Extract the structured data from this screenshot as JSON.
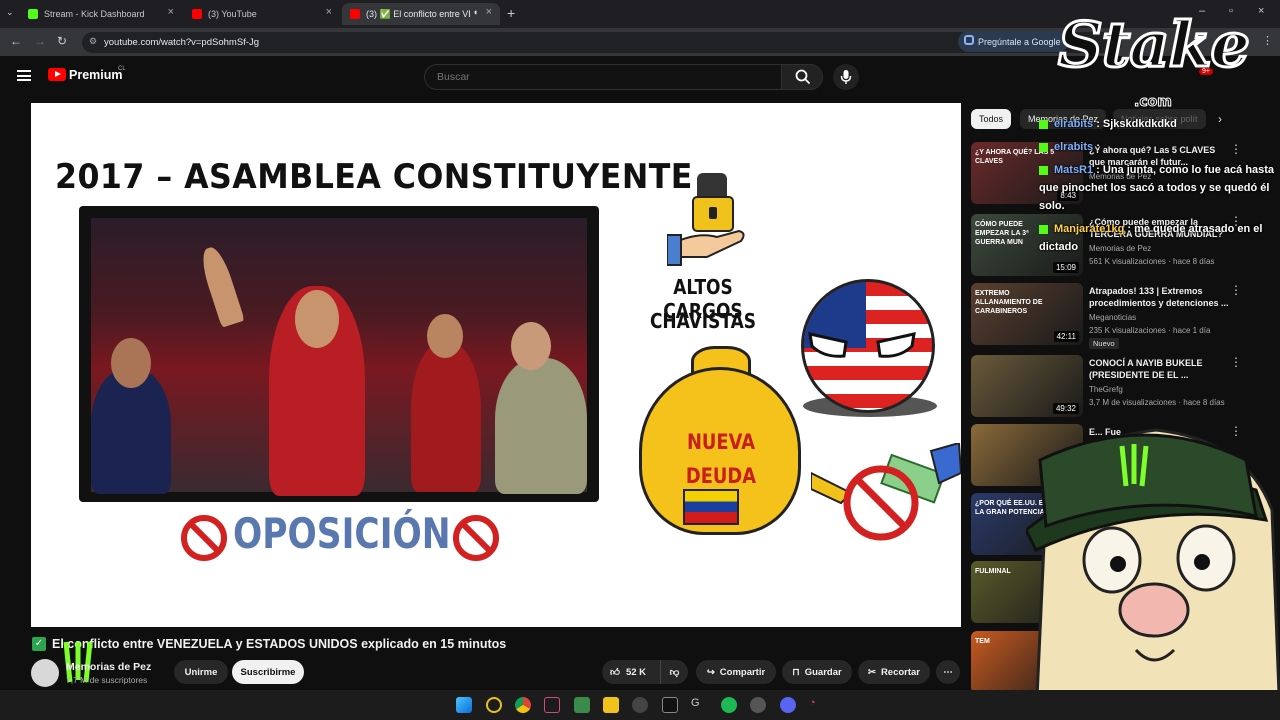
{
  "browser": {
    "tabs": [
      {
        "title": "Stream - Kick Dashboard",
        "fav_color": "#53fc18"
      },
      {
        "title": "(3) YouTube",
        "fav_color": "#ff0000"
      },
      {
        "title": "(3) ✅ El conflicto entre VE…",
        "fav_color": "#ff0000"
      }
    ],
    "new_tab": "+",
    "url": "youtube.com/watch?v=pdSohmSf-Jg",
    "ask_google": "Pregúntale a Google"
  },
  "youtube": {
    "brand": "Premium",
    "country": "CL",
    "search_placeholder": "Buscar",
    "notif_count": "9+"
  },
  "video": {
    "heading": "2017 –  ASAMBLEA CONSTITUYENTE",
    "label_cargos_1": "ALTOS CARGOS",
    "label_cargos_2": "CHAVISTAS",
    "label_deuda_1": "NUEVA",
    "label_deuda_2": "DEUDA",
    "label_oposicion": "OPOSICIÓN"
  },
  "meta": {
    "title": "El conflicto entre VENEZUELA y ESTADOS UNIDOS explicado en 15 minutos",
    "channel": "Memorias de Pez",
    "subs": "7,7 M de suscriptores",
    "join": "Unirme",
    "subscribe": "Suscribirme",
    "likes": "52 K",
    "share": "Compartir",
    "save": "Guardar",
    "clip": "Recortar"
  },
  "sidebar": {
    "chips": [
      "Todos",
      "Memorias de Pez",
      "Noticias sobre polít"
    ],
    "items": [
      {
        "thumb_text": "¿Y AHORA QUÉ? LAS 5 CLAVES",
        "title": "¿Y ahora qué? Las 5 CLAVES que marcarán el futur...",
        "channel": "Memorias de Pez",
        "meta": "",
        "duration": "8:43",
        "color": "#6b2a2a"
      },
      {
        "thumb_text": "CÓMO PUEDE EMPEZAR LA 3ª GUERRA MUN",
        "title": "¿Cómo puede empezar la TERCERA GUERRA MUNDIAL?",
        "channel": "Memorias de Pez",
        "meta": "561 K visualizaciones · hace 8 días",
        "duration": "15:09",
        "color": "#3c4a3c"
      },
      {
        "thumb_text": "EXTREMO ALLANAMIENTO DE CARABINEROS",
        "title": "Atrapados! 133 | Extremos procedimientos y detenciones ...",
        "channel": "Meganoticias",
        "meta": "235 K visualizaciones · hace 1 día",
        "duration": "42:11",
        "color": "#5a4030",
        "badge": "Nuevo"
      },
      {
        "thumb_text": "",
        "title": "CONOCÍ A NAYIB BUKELE (PRESIDENTE DE EL ...",
        "channel": "TheGrefg",
        "meta": "3,7 M de visualizaciones · hace 8 días",
        "duration": "49:32",
        "color": "#6a5a3a"
      },
      {
        "thumb_text": "",
        "title": "E... Fue",
        "channel": "",
        "meta": "",
        "duration": "",
        "color": "#8a6a3a"
      },
      {
        "thumb_text": "¿POR QUÉ EE.UU. ES LA GRAN POTENCIA?",
        "title": "",
        "channel": "",
        "meta": "",
        "duration": "",
        "color": "#2a3a6a"
      },
      {
        "thumb_text": "FULMINAL",
        "title": "",
        "channel": "",
        "meta": "",
        "duration": "",
        "color": "#5a5a2a"
      },
      {
        "thumb_text": "TEM",
        "title": "",
        "channel": "",
        "meta": "",
        "duration": "",
        "color": "#c85a20"
      }
    ]
  },
  "chat": [
    {
      "user": "elrabits",
      "text": " : Sjkskdkdkdkd"
    },
    {
      "user": "elrabits",
      "text": " :"
    },
    {
      "user": "MatsR1",
      "text": " : Una junta, como lo fue acá hasta que pinochet los sacó a todos y se quedó él solo."
    },
    {
      "user": "Manjarate1kg",
      "text": " : me quede atrasado en el dictado"
    }
  ],
  "overlay": {
    "stake": "Stake",
    "stake_com": ".com"
  },
  "colors": {
    "accent_red": "#ff0000",
    "kick_green": "#53fc18",
    "bg": "#0f0f0f"
  }
}
